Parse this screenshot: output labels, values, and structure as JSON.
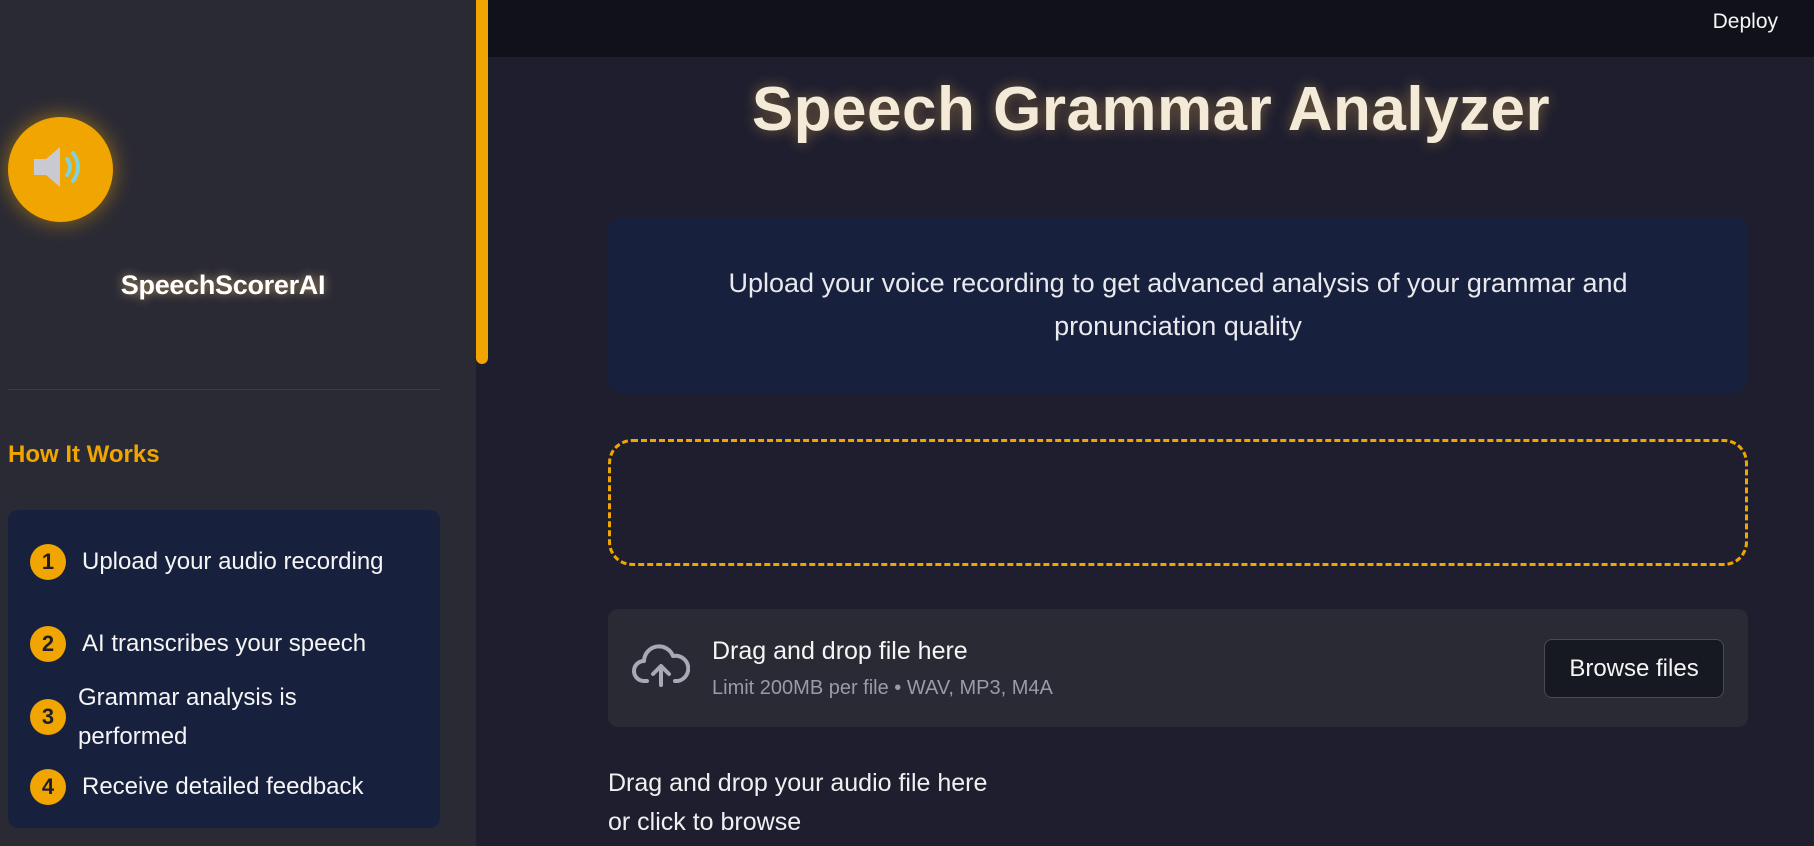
{
  "header": {
    "deploy_label": "Deploy"
  },
  "sidebar": {
    "brand": "SpeechScorerAI",
    "logo_icon": "speaker-icon",
    "how_title": "How It Works",
    "steps": [
      {
        "num": "1",
        "text": "Upload your audio recording"
      },
      {
        "num": "2",
        "text": "AI transcribes your speech"
      },
      {
        "num": "3",
        "text": "Grammar analysis is performed"
      },
      {
        "num": "4",
        "text": "Receive detailed feedback"
      }
    ]
  },
  "main": {
    "title": "Speech Grammar Analyzer",
    "intro": "Upload your voice recording to get advanced analysis of your grammar and pronunciation quality",
    "uploader": {
      "icon": "cloud-upload-icon",
      "title": "Drag and drop file here",
      "limit": "Limit 200MB per file • WAV, MP3, M4A",
      "browse_label": "Browse files"
    },
    "hint_line1": "Drag and drop your audio file here",
    "hint_line2": "or click to browse"
  },
  "colors": {
    "accent": "#f0a500",
    "background": "#1e1e2f",
    "sidebar_bg": "#2a2a35",
    "panel_bg": "#17213e"
  }
}
